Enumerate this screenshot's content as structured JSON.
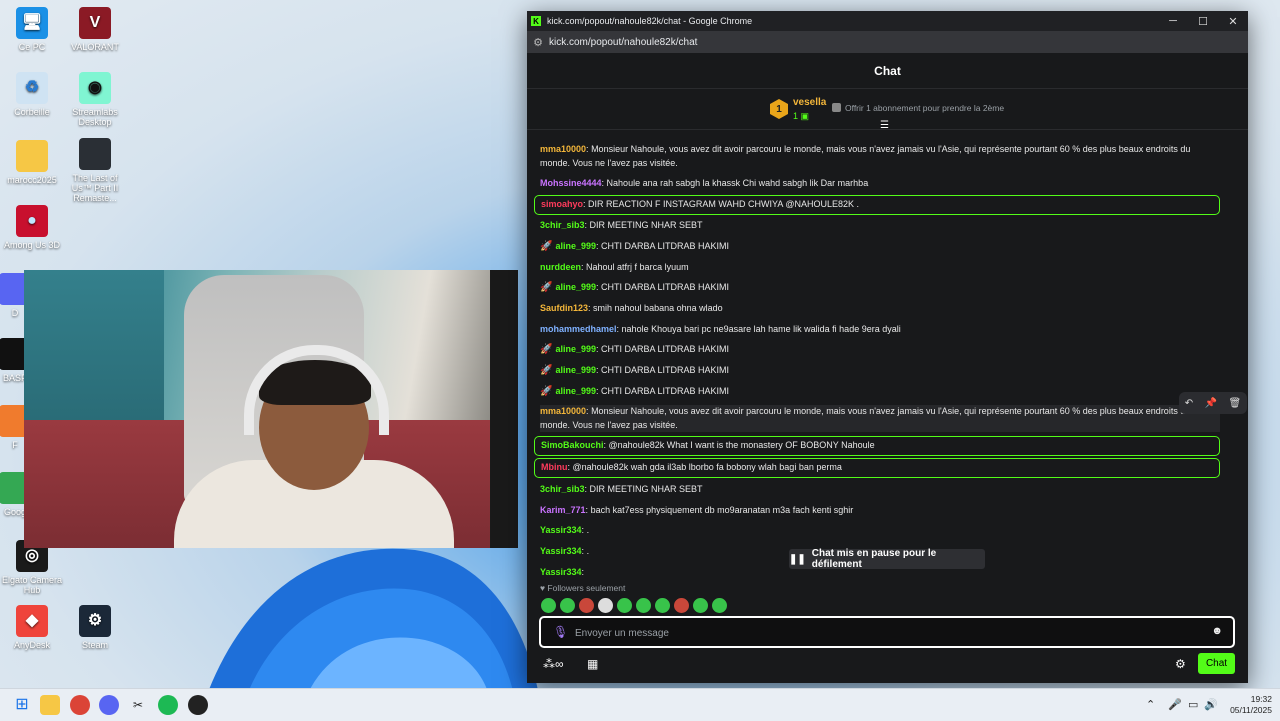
{
  "desktop": {
    "icons": [
      {
        "label": "Ce PC"
      },
      {
        "label": "VALORANT"
      },
      {
        "label": "Corbeille"
      },
      {
        "label": "Streamlabs Desktop"
      },
      {
        "label": "marocc2025"
      },
      {
        "label": "The Last of Us™ Part II Remaste..."
      },
      {
        "label": "Among Us 3D"
      },
      {
        "label": "Elgato Camera Hub"
      },
      {
        "label": "AnyDesk"
      },
      {
        "label": "Steam"
      },
      {
        "label": "Goog"
      },
      {
        "label": "BASP"
      },
      {
        "label": "D"
      },
      {
        "label": "F"
      }
    ]
  },
  "browser": {
    "title": "kick.com/popout/nahoule82k/chat - Google Chrome",
    "url": "kick.com/popout/nahoule82k/chat",
    "controls": {
      "minimize": "─",
      "maximize": "☐",
      "close": "✕"
    }
  },
  "chat": {
    "header": "Chat",
    "pinned": {
      "rank": "1",
      "user": "vesella",
      "count": "1",
      "offer": "Offrir 1 abonnement pour prendre la 2ème"
    },
    "messages": [
      {
        "user": "mma10000",
        "color": "#f3b63a",
        "text": "Monsieur Nahoule, vous avez dit avoir parcouru le monde, mais vous n'avez jamais vu l'Asie, qui représente pourtant 60 % des plus beaux endroits du monde. Vous ne l'avez pas visitée."
      },
      {
        "user": "Mohssine4444",
        "color": "#c973ff",
        "text": "Nahoule ana rah sabgh la khassk Chi wahd sabgh lik Dar marhba"
      },
      {
        "user": "simoahyo",
        "color": "#ff3b5c",
        "text": "DIR REACTION F INSTAGRAM WAHD CHWIYA @NAHOULE82K ."
      },
      {
        "user": "3chir_sib3",
        "color": "#53fc18",
        "text": "DIR MEETING NHAR SEBT"
      },
      {
        "user": "aline_999",
        "color": "#53fc18",
        "text": "CHTI DARBA LITDRAB HAKIMI"
      },
      {
        "user": "nurddeen",
        "color": "#53fc18",
        "text": "Nahoul atfrj f barca lyuum"
      },
      {
        "user": "aline_999",
        "color": "#53fc18",
        "text": "CHTI DARBA LITDRAB HAKIMI"
      },
      {
        "user": "Saufdin123",
        "color": "#f3b63a",
        "text": "smih nahoul babana ohna wlado"
      },
      {
        "user": "mohammedhamel",
        "color": "#7fb1ff",
        "text": "nahole Khouya bari pc ne9asare lah hame lik walida fi hade 9era dyali"
      },
      {
        "user": "aline_999",
        "color": "#53fc18",
        "text": "CHTI DARBA LITDRAB HAKIMI"
      },
      {
        "user": "aline_999",
        "color": "#53fc18",
        "text": "CHTI DARBA LITDRAB HAKIMI"
      },
      {
        "user": "aline_999",
        "color": "#53fc18",
        "text": "CHTI DARBA LITDRAB HAKIMI"
      },
      {
        "user": "mma10000",
        "color": "#f3b63a",
        "text": "Monsieur Nahoule, vous avez dit avoir parcouru le monde, mais vous n'avez jamais vu l'Asie, qui représente pourtant 60 % des plus beaux endroits du monde. Vous ne l'avez pas visitée."
      },
      {
        "user": "SimoBakouchi",
        "color": "#53fc18",
        "text": "@nahoule82k What I want is the monastery OF BOBONY Nahoule"
      },
      {
        "user": "Mbinu",
        "color": "#ff3b5c",
        "text": "@nahoule82k wah gda il3ab lborbo fa bobony wlah bagi ban perma"
      },
      {
        "user": "3chir_sib3",
        "color": "#53fc18",
        "text": "DIR MEETING NHAR SEBT"
      },
      {
        "user": "Karim_771",
        "color": "#c973ff",
        "text": "bach kat7ess physiquement db mo9aranatan m3a fach kenti sghir"
      },
      {
        "user": "Yassir334",
        "color": "#53fc18",
        "text": "."
      },
      {
        "user": "Yassir334",
        "color": "#53fc18",
        "text": "."
      },
      {
        "user": "Yassir334",
        "color": "#53fc18",
        "text": ""
      }
    ],
    "paused_label": "Chat mis en pause pour le défilement",
    "followers_only": "Followers seulement",
    "input_placeholder": "Envoyer un message",
    "send_label": "Chat"
  },
  "taskbar": {
    "time": "19:32",
    "date": "05/11/2025"
  }
}
